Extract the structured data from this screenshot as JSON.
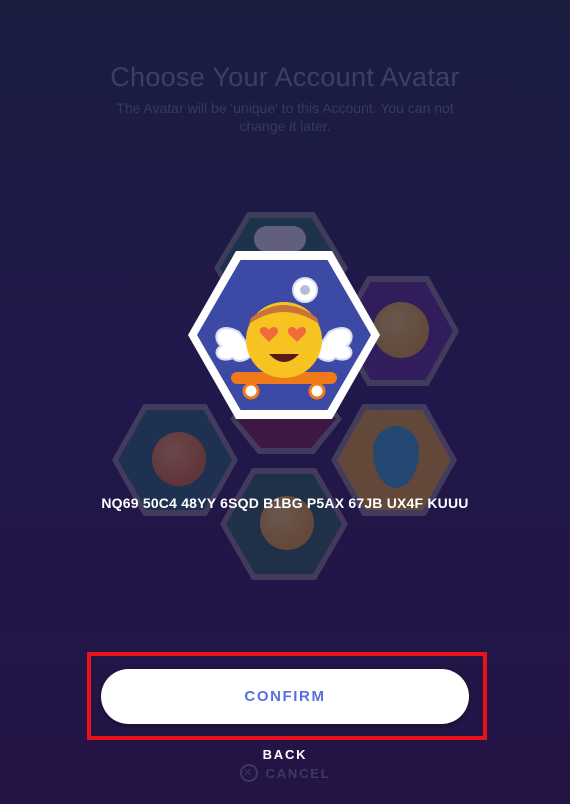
{
  "header": {
    "title": "Choose Your Account Avatar",
    "subtitle": "The Avatar will be 'unique' to this Account. You can not change it later."
  },
  "avatar_code": "NQ69 50C4 48YY 6SQD B1BG P5AX 67JB UX4F KUUU",
  "actions": {
    "confirm_label": "CONFIRM",
    "back_label": "BACK",
    "cancel_label": "CANCEL"
  },
  "icons": {
    "cancel": "close-circle-icon",
    "selected_avatar": "winged-skateboard-emoji-avatar"
  },
  "colors": {
    "accent": "#5a6ee0",
    "highlight_frame": "#e8131a",
    "hex_border": "#ffffff",
    "hex_fill": "#3c4aa6"
  }
}
